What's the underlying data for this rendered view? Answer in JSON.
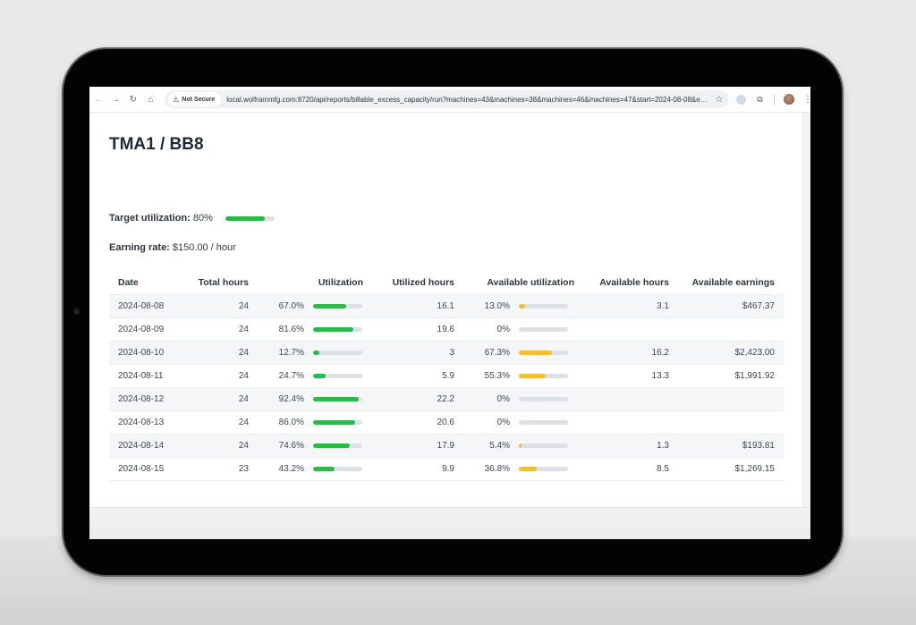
{
  "browser": {
    "nav": {
      "back": "←",
      "forward": "→",
      "reload": "↻",
      "home": "⌂"
    },
    "security_label": "Not Secure",
    "url": "local.wolframmfg.com:8720/api/reports/billable_excess_capacity/run?machines=43&machines=38&machines=46&machines=47&start=2024-08-08&en..."
  },
  "page": {
    "title": "TMA1 / BB8",
    "target_utilization": {
      "label": "Target utilization:",
      "value": "80%",
      "fraction": 0.8
    },
    "earning_rate": {
      "label": "Earning rate:",
      "value": "$150.00 / hour"
    }
  },
  "table": {
    "headers": {
      "date": "Date",
      "total_hours": "Total hours",
      "utilization": "Utilization",
      "utilized_hours": "Utilized hours",
      "available_utilization": "Available utilization",
      "available_hours": "Available hours",
      "available_earnings": "Available earnings"
    },
    "rows": [
      {
        "date": "2024-08-08",
        "total_hours": "24",
        "utilization": "67.0%",
        "utilization_frac": 0.67,
        "utilized_hours": "16.1",
        "available_utilization": "13.0%",
        "available_utilization_frac": 0.13,
        "available_hours": "3.1",
        "available_earnings": "$467.37"
      },
      {
        "date": "2024-08-09",
        "total_hours": "24",
        "utilization": "81.6%",
        "utilization_frac": 0.816,
        "utilized_hours": "19.6",
        "available_utilization": "0%",
        "available_utilization_frac": 0,
        "available_hours": "",
        "available_earnings": ""
      },
      {
        "date": "2024-08-10",
        "total_hours": "24",
        "utilization": "12.7%",
        "utilization_frac": 0.127,
        "utilized_hours": "3",
        "available_utilization": "67.3%",
        "available_utilization_frac": 0.673,
        "available_hours": "16.2",
        "available_earnings": "$2,423.00"
      },
      {
        "date": "2024-08-11",
        "total_hours": "24",
        "utilization": "24.7%",
        "utilization_frac": 0.247,
        "utilized_hours": "5.9",
        "available_utilization": "55.3%",
        "available_utilization_frac": 0.553,
        "available_hours": "13.3",
        "available_earnings": "$1,991.92"
      },
      {
        "date": "2024-08-12",
        "total_hours": "24",
        "utilization": "92.4%",
        "utilization_frac": 0.924,
        "utilized_hours": "22.2",
        "available_utilization": "0%",
        "available_utilization_frac": 0,
        "available_hours": "",
        "available_earnings": ""
      },
      {
        "date": "2024-08-13",
        "total_hours": "24",
        "utilization": "86.0%",
        "utilization_frac": 0.86,
        "utilized_hours": "20.6",
        "available_utilization": "0%",
        "available_utilization_frac": 0,
        "available_hours": "",
        "available_earnings": ""
      },
      {
        "date": "2024-08-14",
        "total_hours": "24",
        "utilization": "74.6%",
        "utilization_frac": 0.746,
        "utilized_hours": "17.9",
        "available_utilization": "5.4%",
        "available_utilization_frac": 0.054,
        "available_hours": "1.3",
        "available_earnings": "$193.81"
      },
      {
        "date": "2024-08-15",
        "total_hours": "23",
        "utilization": "43.2%",
        "utilization_frac": 0.432,
        "utilized_hours": "9.9",
        "available_utilization": "36.8%",
        "available_utilization_frac": 0.368,
        "available_hours": "8.5",
        "available_earnings": "$1,269.15"
      }
    ]
  },
  "colors": {
    "utilization_bar": "#2db84b",
    "available_bar": "#f2bd38",
    "bar_track": "#dde0e4"
  }
}
